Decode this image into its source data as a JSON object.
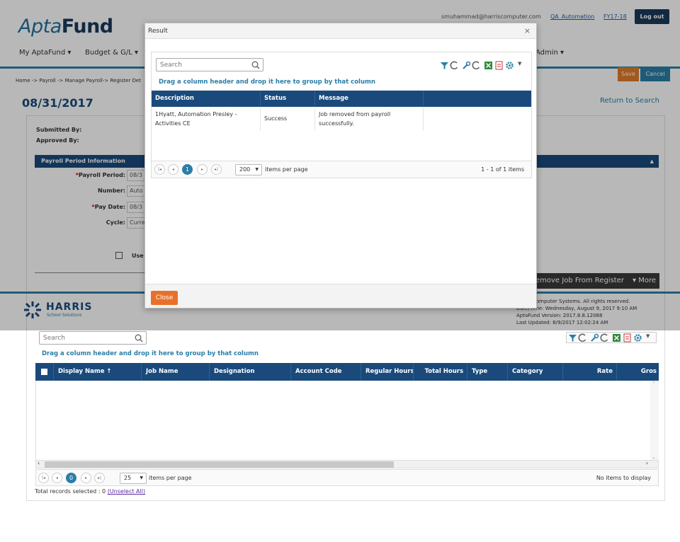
{
  "header": {
    "logo_part1": "Apta",
    "logo_part2": "Fund",
    "user_email": "smuhammad@harriscomputer.com",
    "role_link": "QA_Automation",
    "fiscal_year_link": "FY17-18",
    "logout_label": "Log out"
  },
  "nav": {
    "items": [
      "My AptaFund ▾",
      "Budget & G/L ▾",
      "Admin ▾"
    ]
  },
  "breadcrumb": "Home -> Payroll -> Manage Payroll-> Register Det",
  "actions": {
    "save_label": "Save",
    "cancel_label": "Cancel"
  },
  "page": {
    "title": "08/31/2017",
    "return_link": "Return to Search",
    "submitted_by_label": "Submitted By:",
    "approved_by_label": "Approved By:"
  },
  "payroll_section": {
    "header": "Payroll Period Information",
    "fields": [
      {
        "label": "Payroll Period:",
        "required": true,
        "value": "08/3"
      },
      {
        "label": "Number:",
        "required": false,
        "value": "Auto"
      },
      {
        "label": "Pay Date:",
        "required": true,
        "value": "08/3"
      },
      {
        "label": "Cycle:",
        "required": false,
        "value": "Curre"
      }
    ],
    "use_checkbox_label": "Use"
  },
  "more_bar": {
    "remove_label": "emove Job From Register",
    "more_label": "▾ More"
  },
  "footer": {
    "brand": "HARRIS",
    "brand_sub": "School Solutions",
    "lines": [
      "Harris Computer Systems. All rights reserved.",
      "Date/Time: Wednesday, August 9, 2017 9:10 AM",
      "AptaFund Version: 2017.8.8.12088",
      "Last Updated: 8/9/2017 12:02:24 AM"
    ]
  },
  "modal": {
    "title": "Result",
    "close_x": "×",
    "search_placeholder": "Search",
    "drag_hint": "Drag a column header and drop it here to group by that column",
    "columns": [
      "Description",
      "Status",
      "Message"
    ],
    "rows": [
      {
        "description": "1Hyatt, Automation Presley - Activities CE",
        "status": "Success",
        "message": "Job removed from payroll successfully."
      }
    ],
    "pager": {
      "current_page": "1",
      "page_size": "200",
      "items_per_page": "items per page",
      "range": "1 - 1 of 1 items"
    },
    "close_button": "Close"
  },
  "grid": {
    "search_placeholder": "Search",
    "drag_hint": "Drag a column header and drop it here to group by that column",
    "columns": [
      "Display Name ↑",
      "Job Name",
      "Designation",
      "Account Code",
      "Regular Hours",
      "Total Hours",
      "Type",
      "Category",
      "Rate",
      "Gros"
    ],
    "pager": {
      "current_page": "0",
      "page_size": "25",
      "items_per_page": "items per page",
      "empty": "No items to display"
    },
    "total_records_label": "Total records selected : 0",
    "unselect_all": "(Unselect All)"
  },
  "colors": {
    "brand_dark": "#1a4a7c",
    "accent_blue": "#2a7ea7",
    "save_orange": "#e07c2a",
    "close_orange": "#e8712a"
  }
}
